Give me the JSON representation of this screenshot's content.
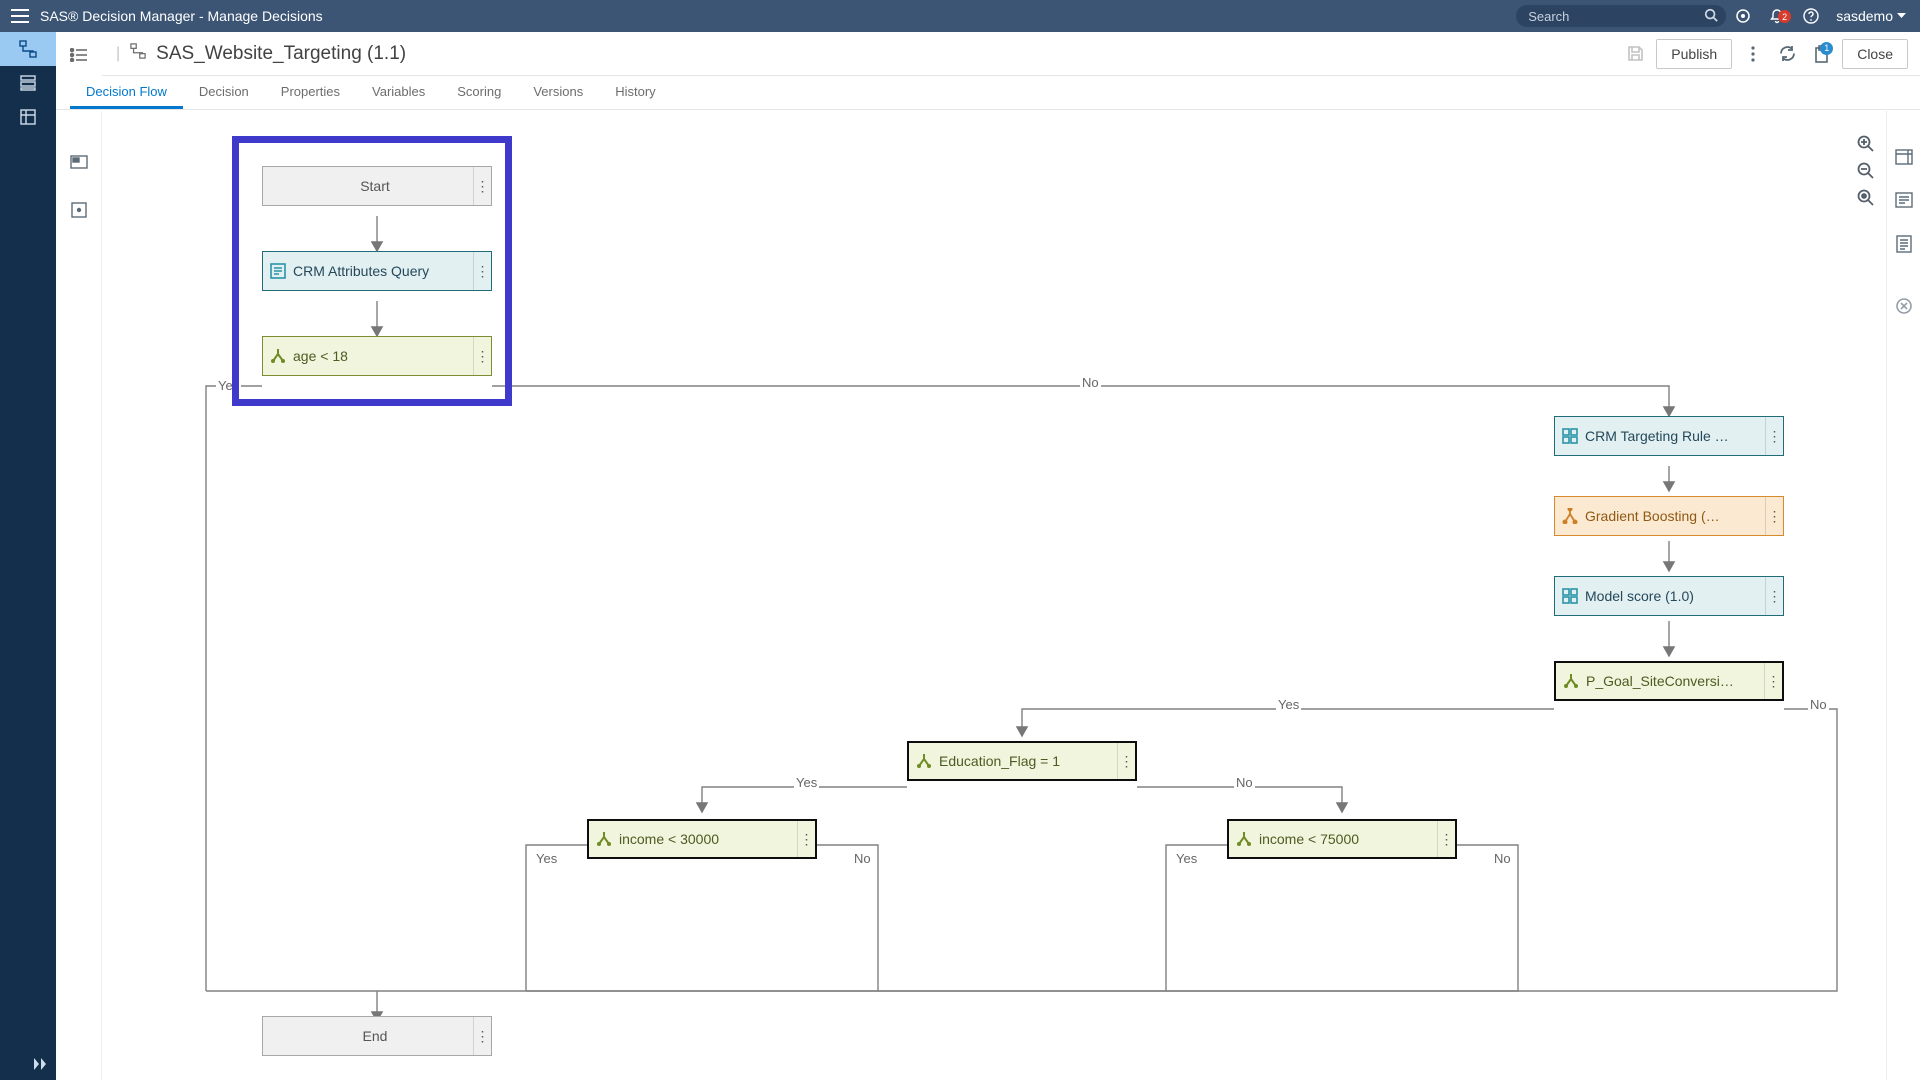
{
  "app": {
    "title": "SAS® Decision Manager - Manage Decisions"
  },
  "search": {
    "placeholder": "Search"
  },
  "user": {
    "name": "sasdemo"
  },
  "bell_badge": "2",
  "clip_badge": "1",
  "breadcrumb": {
    "title": "SAS_Website_Targeting (1.1)"
  },
  "actions": {
    "publish": "Publish",
    "close": "Close"
  },
  "tabs": [
    "Decision Flow",
    "Decision",
    "Properties",
    "Variables",
    "Scoring",
    "Versions",
    "History"
  ],
  "active_tab": 0,
  "nodes": {
    "start": "Start",
    "crm_query": "CRM Attributes Query",
    "age": "age < 18",
    "crm_target": "CRM Targeting Rule …",
    "gboost": "Gradient Boosting (…",
    "mscore": "Model score (1.0)",
    "pgoal": "P_Goal_SiteConversi…",
    "edu": "Education_Flag = 1",
    "inc30": "income < 30000",
    "inc75": "income < 75000",
    "end": "End"
  },
  "labels": {
    "yes": "Yes",
    "no": "No"
  }
}
